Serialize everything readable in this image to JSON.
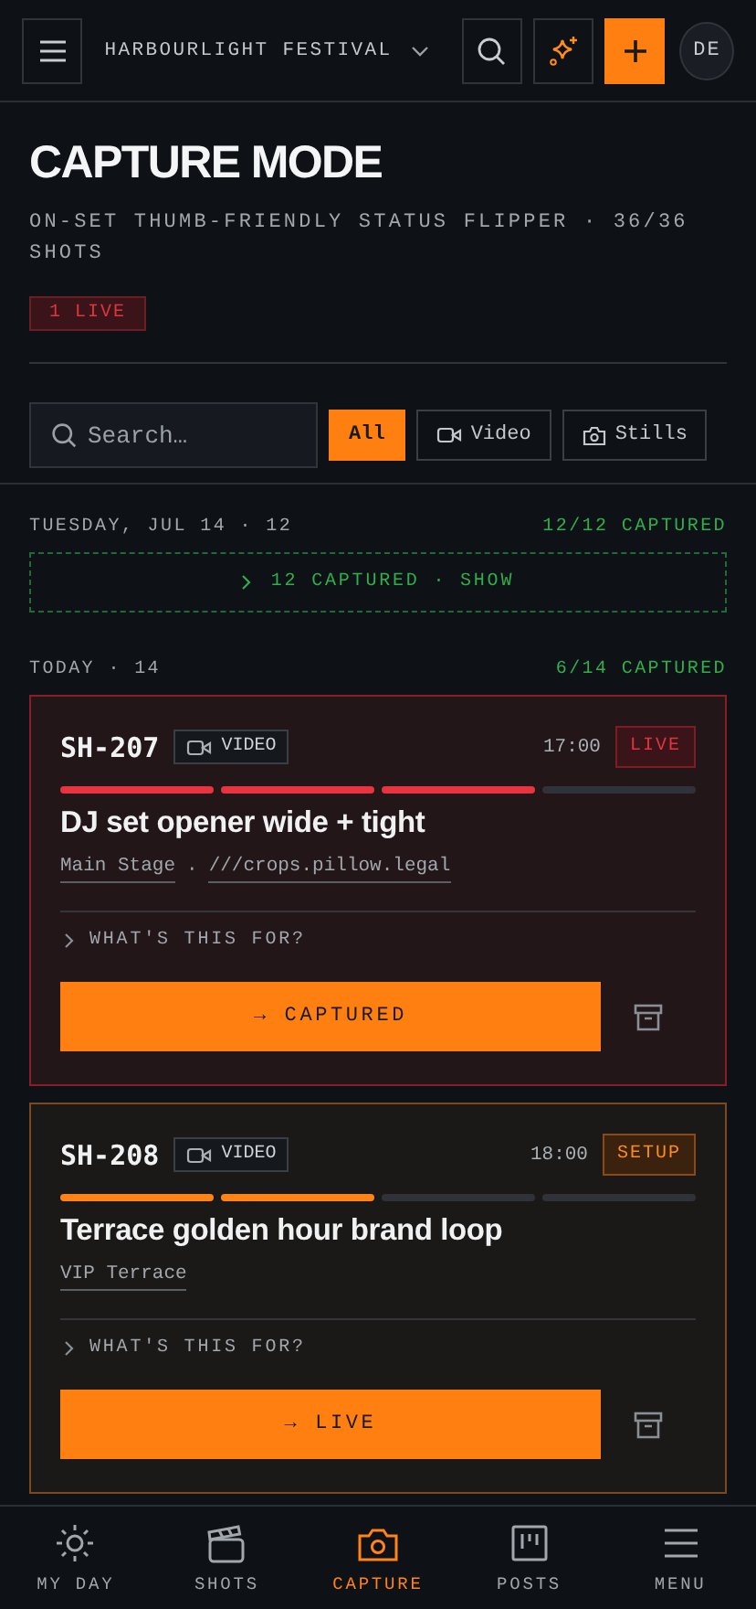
{
  "header": {
    "project": "HARBOURLIGHT FESTIVAL",
    "avatar": "DE"
  },
  "page": {
    "title": "CAPTURE MODE",
    "subtitle": "ON-SET THUMB-FRIENDLY STATUS FLIPPER · 36/36 SHOTS",
    "live_badge": "1 LIVE"
  },
  "search": {
    "placeholder": "Search…"
  },
  "filters": [
    {
      "label": "All",
      "selected": true
    },
    {
      "label": "Video",
      "selected": false
    },
    {
      "label": "Stills",
      "selected": false
    }
  ],
  "groups": [
    {
      "heading": "TUESDAY, JUL 14 · 12",
      "count": "12/12 CAPTURED",
      "collapsed": "12 CAPTURED · SHOW"
    },
    {
      "heading": "TODAY · 14",
      "count": "6/14 CAPTURED",
      "shots": [
        {
          "id": "SH-207",
          "type": "VIDEO",
          "time": "17:00",
          "status": "LIVE",
          "kind": "live",
          "steps": [
            {
              "done": true
            },
            {
              "done": true
            },
            {
              "done": true
            },
            {
              "done": false
            }
          ],
          "title": "DJ set opener wide + tight",
          "location": "Main Stage",
          "separator": "·",
          "address": "///crops.pillow.legal",
          "expander": "WHAT'S THIS FOR?",
          "action": "→ CAPTURED"
        },
        {
          "id": "SH-208",
          "type": "VIDEO",
          "time": "18:00",
          "status": "SETUP",
          "kind": "setup",
          "steps": [
            {
              "done": true
            },
            {
              "done": true
            },
            {
              "done": false
            },
            {
              "done": false
            }
          ],
          "title": "Terrace golden hour brand loop",
          "location": "VIP Terrace",
          "expander": "WHAT'S THIS FOR?",
          "action": "→ LIVE"
        }
      ]
    }
  ],
  "nav": [
    {
      "label": "MY DAY",
      "selected": false
    },
    {
      "label": "SHOTS",
      "selected": false
    },
    {
      "label": "CAPTURE",
      "selected": true
    },
    {
      "label": "POSTS",
      "selected": false
    },
    {
      "label": "MENU",
      "selected": false
    }
  ]
}
